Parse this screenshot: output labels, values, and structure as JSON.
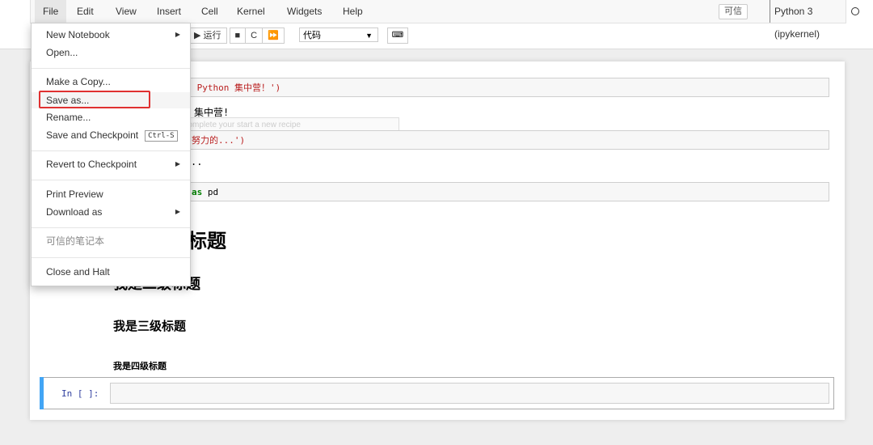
{
  "menubar": {
    "items": [
      "File",
      "Edit",
      "View",
      "Insert",
      "Cell",
      "Kernel",
      "Widgets",
      "Help"
    ],
    "trusted": "可信",
    "kernel": "Python 3 (ipykernel)"
  },
  "toolbar": {
    "run_label": "▶ 运行",
    "stop_icon": "■",
    "restart_icon": "C",
    "restart_run_icon": "⏩",
    "cell_type": "代码"
  },
  "file_menu": {
    "items": [
      {
        "label": "New Notebook",
        "submenu": true
      },
      {
        "label": "Open..."
      },
      {
        "label": "Make a Copy..."
      },
      {
        "label": "Save as...",
        "highlighted": true
      },
      {
        "label": "Rename..."
      },
      {
        "label": "Save and Checkpoint",
        "shortcut": "Ctrl-S"
      },
      {
        "label": "Revert to Checkpoint",
        "submenu": true
      },
      {
        "label": "Print Preview"
      },
      {
        "label": "Download as",
        "submenu": true
      },
      {
        "label": "可信的笔记本",
        "disabled": true
      },
      {
        "label": "Close and Halt"
      }
    ]
  },
  "cells": {
    "code1_tail": " Python 集中营！')",
    "out1_tail": "集中营!",
    "tooltip": "ick Ctrl-K to complete your start a new recipe",
    "code2_tail": "努力的...')",
    "out2_tail": "..",
    "code3_kw": "as",
    "code3_tail": " pd",
    "h1_tail": "标题",
    "h2": "我是二级标题",
    "h3": "我是三级标题",
    "h4": "我是四级标题",
    "prompt": "In [ ]:"
  },
  "colors": {
    "accent": "#42a5f5",
    "highlight_box": "#e03131",
    "string": "#ba2121"
  }
}
